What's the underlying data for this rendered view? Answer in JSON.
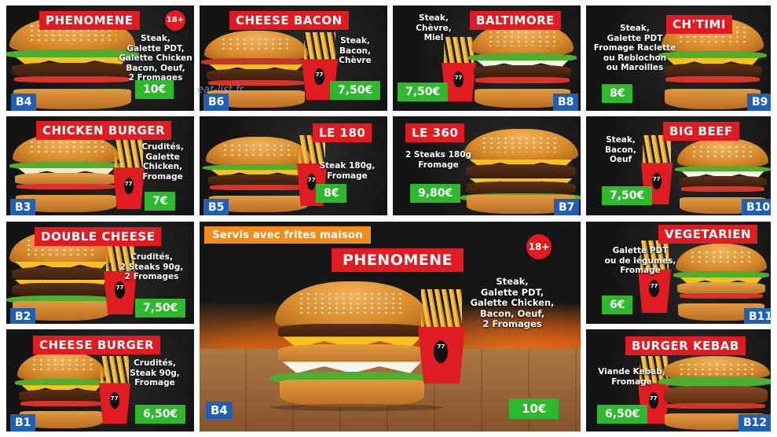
{
  "watermark": "eat-list.fr",
  "currency_note": "Servis avec frites maison",
  "cards": [
    {
      "id": "b4",
      "title": "PHENOMENE",
      "desc": "Steak,\nGalette PDT,\nGalette Chicken\nBacon, Oeuf,\n2 Fromages",
      "price": "10€",
      "code": "B4",
      "badge": "18+"
    },
    {
      "id": "b6",
      "title": "CHEESE BACON",
      "desc": "Steak,\nBacon,\nChèvre",
      "price": "7,50€",
      "code": "B6"
    },
    {
      "id": "b8",
      "title": "BALTIMORE",
      "desc": "Steak,\nChèvre,\nMiel",
      "price": "7,50€",
      "code": "B8"
    },
    {
      "id": "b9",
      "title": "CH'TIMI",
      "desc": "Steak,\nGalette PDT\nFromage Raclette\nou Reblochon\nou Maroilles",
      "price": "8€",
      "code": "B9"
    },
    {
      "id": "b3",
      "title": "CHICKEN BURGER",
      "desc": "Crudités,\nGalette\nChicken,\nFromage",
      "price": "7€",
      "code": "B3"
    },
    {
      "id": "b5",
      "title": "LE 180",
      "desc": "Steak 180g,\nFromage",
      "price": "8€",
      "code": "B5"
    },
    {
      "id": "b7",
      "title": "LE 360",
      "desc": "2 Steaks 180g\nFromage",
      "price": "9,80€",
      "code": "B7"
    },
    {
      "id": "b10",
      "title": "BIG BEEF",
      "desc": "Steak,\nBacon,\nOeuf",
      "price": "7,50€",
      "code": "B10"
    },
    {
      "id": "b2",
      "title": "DOUBLE CHEESE",
      "desc": "Crudités,\n2 Steaks 90g,\n2 Fromages",
      "price": "7,50€",
      "code": "B2"
    },
    {
      "id": "b11",
      "title": "VEGETARIEN",
      "desc": "Galette PDT\nou de légumes,\nFromage",
      "price": "6€",
      "code": "B11"
    },
    {
      "id": "b1",
      "title": "CHEESE BURGER",
      "desc": "Crudités,\nSteak 90g,\nFromage",
      "price": "6,50€",
      "code": "B1"
    },
    {
      "id": "b12",
      "title": "BURGER KEBAB",
      "desc": "Viande Kebab,\nFromage",
      "price": "6,50€",
      "code": "B12"
    }
  ],
  "featured": {
    "title": "PHENOMENE",
    "desc": "Steak,\nGalette PDT,\nGalette Chicken,\nBacon, Oeuf,\n2 Fromages",
    "price": "10€",
    "code": "B4",
    "badge": "18+"
  },
  "fries_logo": "77",
  "colors": {
    "title_red": "#e11b22",
    "price_green": "#2db82d",
    "code_blue": "#1f5fb8",
    "banner_orange": "#f28c1c"
  }
}
